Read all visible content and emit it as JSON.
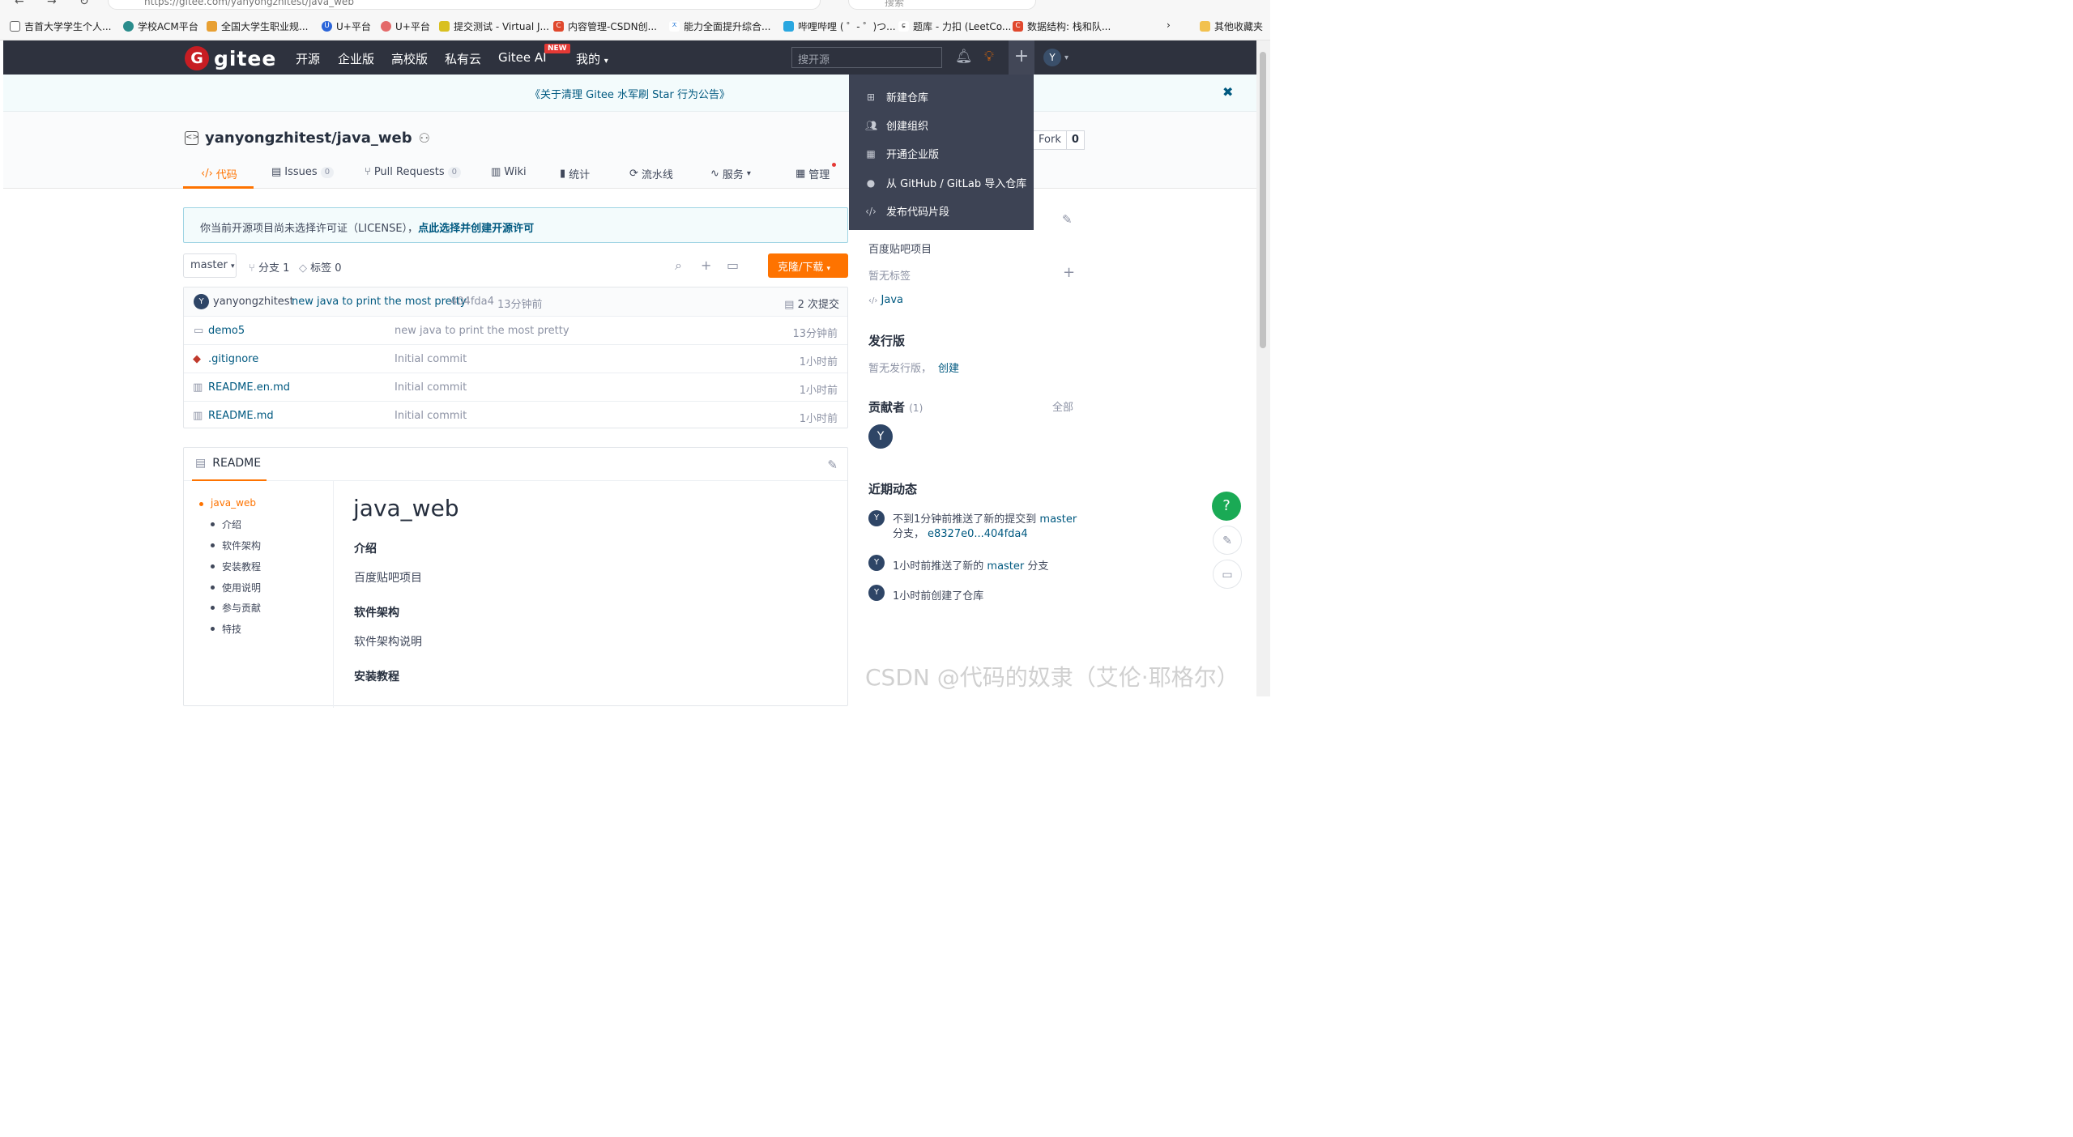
{
  "browser": {
    "url": "https://gitee.com/yanyongzhitest/java_web",
    "search_placeholder": "搜索",
    "bookmarks": [
      "吉首大学学生个人...",
      "学校ACM平台",
      "全国大学生职业规...",
      "U+平台",
      "U+平台",
      "提交测试 - Virtual J...",
      "内容管理-CSDN创...",
      "能力全面提升综合...",
      "哔哩哔哩 ( ゜- ゜)つ...",
      "题库 - 力扣 (LeetCo...",
      "数据结构: 栈和队...",
      "其他收藏夹"
    ]
  },
  "header": {
    "logo_text": "gitee",
    "logo_letter": "G",
    "nav": [
      "开源",
      "企业版",
      "高校版",
      "私有云",
      "Gitee AI",
      "我的"
    ],
    "new_badge": "NEW",
    "search_placeholder": "搜开源",
    "user_initial": "Y"
  },
  "notice": {
    "text": "《关于清理 Gitee 水军刷 Star 行为公告》",
    "close": "✖"
  },
  "repo": {
    "owner_repo": "yanyongzhitest/java_web",
    "fork_label": "Fork",
    "fork_count": "0",
    "tabs": [
      {
        "label": "代码",
        "count": ""
      },
      {
        "label": "Issues",
        "count": "0"
      },
      {
        "label": "Pull Requests",
        "count": "0"
      },
      {
        "label": "Wiki",
        "count": ""
      },
      {
        "label": "统计",
        "count": ""
      },
      {
        "label": "流水线",
        "count": ""
      },
      {
        "label": "服务",
        "count": ""
      },
      {
        "label": "管理",
        "count": ""
      }
    ]
  },
  "license": {
    "text": "你当前开源项目尚未选择许可证（LICENSE），",
    "link": "点此选择并创建开源许可"
  },
  "branchbar": {
    "branch": "master",
    "branches": "分支 1",
    "tags": "标签 0",
    "clone": "克隆/下载"
  },
  "commit": {
    "avatar": "Y",
    "author": "yanyongzhitest",
    "message": "new java to print the most pretty",
    "hash": "404fda4",
    "time": "13分钟前",
    "commits": "2 次提交"
  },
  "files": [
    {
      "name": "demo5",
      "message": "new java to print the most pretty",
      "time": "13分钟前",
      "icon": "folder-icon"
    },
    {
      "name": ".gitignore",
      "message": "Initial commit",
      "time": "1小时前",
      "icon": "git-icon"
    },
    {
      "name": "README.en.md",
      "message": "Initial commit",
      "time": "1小时前",
      "icon": "book-icon"
    },
    {
      "name": "README.md",
      "message": "Initial commit",
      "time": "1小时前",
      "icon": "book-icon"
    }
  ],
  "readme": {
    "tab": "README",
    "toc": [
      "java_web",
      "介绍",
      "软件架构",
      "安装教程",
      "使用说明",
      "参与贡献",
      "特技"
    ],
    "h1": "java_web",
    "sections": [
      {
        "heading": "介绍",
        "body": "百度贴吧项目"
      },
      {
        "heading": "软件架构",
        "body": "软件架构说明"
      },
      {
        "heading": "安装教程",
        "body": ""
      }
    ]
  },
  "sidebar": {
    "description": "百度贴吧项目",
    "no_tags": "暂无标签",
    "language": "Java",
    "releases_title": "发行版",
    "releases_text": "暂无发行版，",
    "releases_create": "创建",
    "contributors_title": "贡献者",
    "contributors_count": "(1)",
    "contributors_all": "全部",
    "contributor_initial": "Y",
    "activity_title": "近期动态",
    "activities": [
      {
        "line1_pre": "不到1分钟前推送了新的提交到 ",
        "line1_link": "master",
        "line2_pre": "分支，",
        "line2_link": "e8327e0...404fda4"
      },
      {
        "line1_pre": "1小时前推送了新的 ",
        "line1_link": "master",
        "line1_post": " 分支"
      },
      {
        "line1_pre": "1小时前创建了仓库"
      }
    ]
  },
  "dropdown": {
    "items": [
      "新建仓库",
      "创建组织",
      "开通企业版",
      "从 GitHub / GitLab 导入仓库",
      "发布代码片段"
    ]
  },
  "watermark": "CSDN @代码的奴隶（艾伦·耶格尔）",
  "colors": {
    "accent": "#fe7300",
    "header_bg": "#2e323e",
    "link": "#005980",
    "help_green": "#1aaa55"
  }
}
